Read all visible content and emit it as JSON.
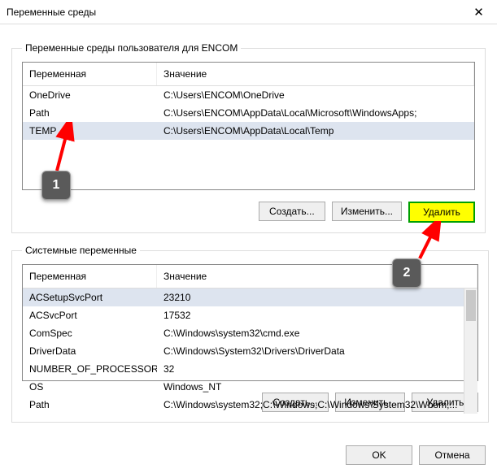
{
  "window": {
    "title": "Переменные среды"
  },
  "user_group": {
    "legend": "Переменные среды пользователя для ENCOM",
    "columns": {
      "name": "Переменная",
      "value": "Значение"
    },
    "rows": [
      {
        "name": "OneDrive",
        "value": "C:\\Users\\ENCOM\\OneDrive",
        "selected": false
      },
      {
        "name": "Path",
        "value": "C:\\Users\\ENCOM\\AppData\\Local\\Microsoft\\WindowsApps;",
        "selected": false
      },
      {
        "name": "TEMP",
        "value": "C:\\Users\\ENCOM\\AppData\\Local\\Temp",
        "selected": true
      }
    ],
    "buttons": {
      "new": "Создать...",
      "edit": "Изменить...",
      "delete": "Удалить"
    }
  },
  "system_group": {
    "legend": "Системные переменные",
    "columns": {
      "name": "Переменная",
      "value": "Значение"
    },
    "rows": [
      {
        "name": "ACSetupSvcPort",
        "value": "23210",
        "selected": true
      },
      {
        "name": "ACSvcPort",
        "value": "17532",
        "selected": false
      },
      {
        "name": "ComSpec",
        "value": "C:\\Windows\\system32\\cmd.exe",
        "selected": false
      },
      {
        "name": "DriverData",
        "value": "C:\\Windows\\System32\\Drivers\\DriverData",
        "selected": false
      },
      {
        "name": "NUMBER_OF_PROCESSORS",
        "value": "32",
        "selected": false
      },
      {
        "name": "OS",
        "value": "Windows_NT",
        "selected": false
      },
      {
        "name": "Path",
        "value": "C:\\Windows\\system32;C:\\Windows;C:\\Windows\\System32\\Wbem;...",
        "selected": false
      }
    ],
    "buttons": {
      "new": "Создать...",
      "edit": "Изменить...",
      "delete": "Удалить"
    }
  },
  "dialog_buttons": {
    "ok": "OK",
    "cancel": "Отмена"
  },
  "annotations": {
    "badge1": "1",
    "badge2": "2"
  }
}
